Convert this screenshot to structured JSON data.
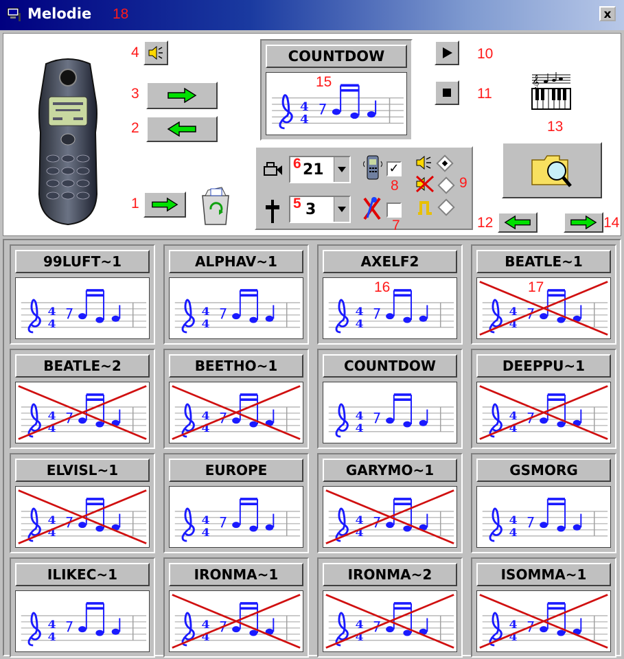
{
  "window": {
    "title": "Melodie",
    "title_number": "18",
    "close_label": "x"
  },
  "controls": {
    "preview_title": "COUNTDOW",
    "preview_number": "15",
    "tempo_value": "21",
    "tempo_number": "6",
    "octave_value": "3",
    "octave_number": "5",
    "labels": {
      "speaker": "4",
      "upload": "3",
      "download": "2",
      "send": "1",
      "play": "10",
      "stop": "11",
      "open": "13",
      "prev_page": "12",
      "next_page": "14",
      "vibra": "8",
      "mute": "9",
      "cut": "7"
    }
  },
  "melodies": [
    {
      "name": "99LUFT~1",
      "crossed": false,
      "number": ""
    },
    {
      "name": "ALPHAV~1",
      "crossed": false,
      "number": ""
    },
    {
      "name": "AXELF2",
      "crossed": false,
      "number": "16"
    },
    {
      "name": "BEATLE~1",
      "crossed": true,
      "number": "17"
    },
    {
      "name": "BEATLE~2",
      "crossed": true,
      "number": ""
    },
    {
      "name": "BEETHO~1",
      "crossed": true,
      "number": ""
    },
    {
      "name": "COUNTDOW",
      "crossed": false,
      "number": ""
    },
    {
      "name": "DEEPPU~1",
      "crossed": true,
      "number": ""
    },
    {
      "name": "ELVISL~1",
      "crossed": true,
      "number": ""
    },
    {
      "name": "EUROPE",
      "crossed": false,
      "number": ""
    },
    {
      "name": "GARYMO~1",
      "crossed": true,
      "number": ""
    },
    {
      "name": "GSMORG",
      "crossed": false,
      "number": ""
    },
    {
      "name": "ILIKEC~1",
      "crossed": false,
      "number": ""
    },
    {
      "name": "IRONMA~1",
      "crossed": true,
      "number": ""
    },
    {
      "name": "IRONMA~2",
      "crossed": true,
      "number": ""
    },
    {
      "name": "ISOMMA~1",
      "crossed": true,
      "number": ""
    }
  ],
  "colors": {
    "annotation": "#ff1a1a",
    "note_blue": "#1a1aff",
    "arrow_green": "#00e000",
    "panel_gray": "#c0c0c0"
  }
}
